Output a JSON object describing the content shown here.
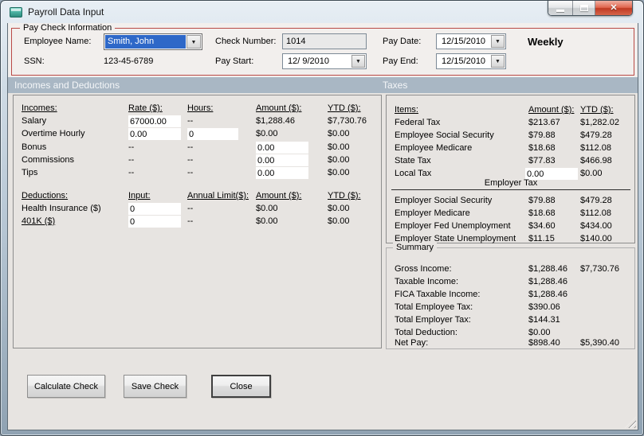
{
  "colors": {
    "section_header_bg": "#a9b7c4",
    "paygroup_border": "#b94a46",
    "selection_blue": "#2e68c8",
    "close_button_red": "#c03a22"
  },
  "window": {
    "title": "Payroll Data Input"
  },
  "icons": {
    "dropdown": "▼",
    "close": "✕"
  },
  "pay_check": {
    "group_label": "Pay Check Information",
    "employee_name_label": "Employee Name:",
    "employee_name_value": "Smith, John",
    "ssn_label": "SSN:",
    "ssn_value": "123-45-6789",
    "check_number_label": "Check Number:",
    "check_number_value": "1014",
    "pay_start_label": "Pay Start:",
    "pay_start_value": "12/ 9/2010",
    "pay_date_label": "Pay Date:",
    "pay_date_value": "12/15/2010",
    "pay_end_label": "Pay End:",
    "pay_end_value": "12/15/2010",
    "frequency": "Weekly"
  },
  "section_headers": {
    "left": "Incomes and Deductions",
    "right": "Taxes"
  },
  "incomes": {
    "headers": {
      "col0": "Incomes:",
      "col1": "Rate ($):",
      "col2": "Hours:",
      "col3": "Amount ($):",
      "col4": "YTD ($):"
    },
    "rows": [
      {
        "label": "Salary",
        "rate": "67000.00",
        "hours": "--",
        "amount": "$1,288.46",
        "ytd": "$7,730.76"
      },
      {
        "label": "Overtime Hourly",
        "rate": "0.00",
        "hours": "0",
        "amount": "$0.00",
        "ytd": "$0.00"
      },
      {
        "label": "Bonus",
        "rate": "--",
        "hours": "--",
        "amount": "0.00",
        "ytd": "$0.00"
      },
      {
        "label": "Commissions",
        "rate": "--",
        "hours": "--",
        "amount": "0.00",
        "ytd": "$0.00"
      },
      {
        "label": "Tips",
        "rate": "--",
        "hours": "--",
        "amount": "0.00",
        "ytd": "$0.00"
      }
    ]
  },
  "deductions": {
    "headers": {
      "col0": "Deductions:",
      "col1": "Input:",
      "col2": "Annual Limit($):",
      "col3": "Amount ($):",
      "col4": "YTD ($):"
    },
    "rows": [
      {
        "label": "Health Insurance ($)",
        "input": "0",
        "limit": "--",
        "amount": "$0.00",
        "ytd": "$0.00"
      },
      {
        "label": "401K ($)",
        "input": "0",
        "limit": "--",
        "amount": "$0.00",
        "ytd": "$0.00"
      }
    ]
  },
  "taxes": {
    "headers": {
      "col0": "Items:",
      "col1": "Amount ($):",
      "col2": "YTD ($):"
    },
    "employee_rows": [
      {
        "label": "Federal Tax",
        "amount": "$213.67",
        "ytd": "$1,282.02"
      },
      {
        "label": "Employee Social Security",
        "amount": "$79.88",
        "ytd": "$479.28"
      },
      {
        "label": "Employee Medicare",
        "amount": "$18.68",
        "ytd": "$112.08"
      },
      {
        "label": "State Tax",
        "amount": "$77.83",
        "ytd": "$466.98"
      }
    ],
    "local_tax": {
      "label": "Local Tax",
      "amount": "0.00",
      "ytd": "$0.00"
    },
    "employer_header": "Employer Tax",
    "employer_rows": [
      {
        "label": "Employer Social Security",
        "amount": "$79.88",
        "ytd": "$479.28"
      },
      {
        "label": "Employer Medicare",
        "amount": "$18.68",
        "ytd": "$112.08"
      },
      {
        "label": "Employer Fed Unemployment",
        "amount": "$34.60",
        "ytd": "$434.00"
      },
      {
        "label": "Employer State Unemployment",
        "amount": "$11.15",
        "ytd": "$140.00"
      }
    ]
  },
  "summary": {
    "group_label": "Summary",
    "rows": [
      {
        "label": "Gross Income:",
        "amount": "$1,288.46",
        "ytd": "$7,730.76"
      },
      {
        "label": "Taxable Income:",
        "amount": "$1,288.46",
        "ytd": ""
      },
      {
        "label": "FICA Taxable Income:",
        "amount": "$1,288.46",
        "ytd": ""
      },
      {
        "label": "Total Employee Tax:",
        "amount": "$390.06",
        "ytd": ""
      },
      {
        "label": "Total Employer Tax:",
        "amount": "$144.31",
        "ytd": ""
      },
      {
        "label": "Total Deduction:",
        "amount": "$0.00",
        "ytd": ""
      },
      {
        "label": "Net Pay:",
        "amount": "$898.40",
        "ytd": "$5,390.40"
      }
    ]
  },
  "buttons": {
    "calculate": "Calculate Check",
    "save": "Save Check",
    "close": "Close"
  }
}
